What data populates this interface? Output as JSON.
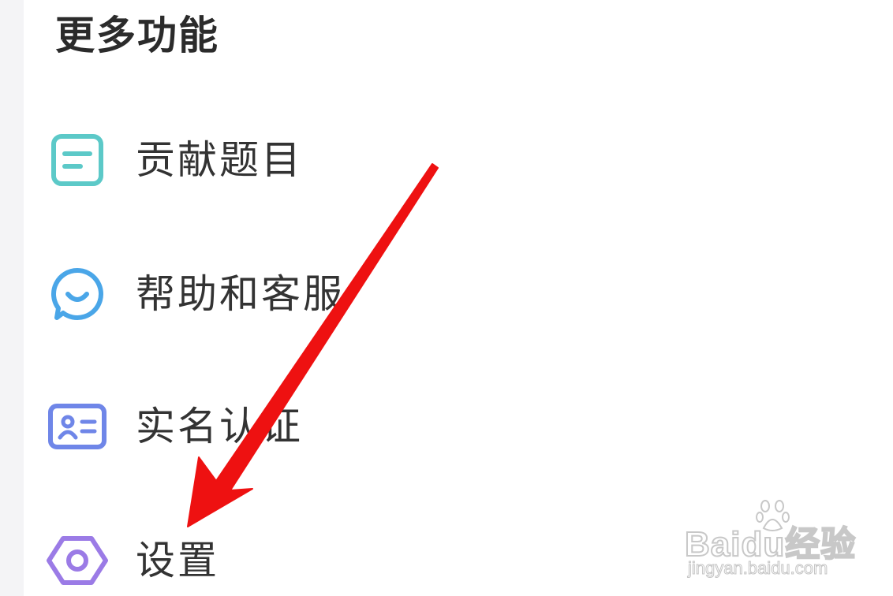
{
  "section": {
    "title": "更多功能"
  },
  "menu": [
    {
      "label": "贡献题目",
      "icon": "note-icon",
      "color": "#5cc9c8"
    },
    {
      "label": "帮助和客服",
      "icon": "chat-bubble-icon",
      "color": "#4aa6e8"
    },
    {
      "label": "实名认证",
      "icon": "id-card-icon",
      "color": "#6f86e8"
    },
    {
      "label": "设置",
      "icon": "hexagon-settings-icon",
      "color": "#9b7be6"
    }
  ],
  "annotation": {
    "arrow_color": "#ee1111",
    "arrow_target": "设置"
  },
  "watermark": {
    "brand": "Baidu经验",
    "url": "jingyan.baidu.com"
  }
}
